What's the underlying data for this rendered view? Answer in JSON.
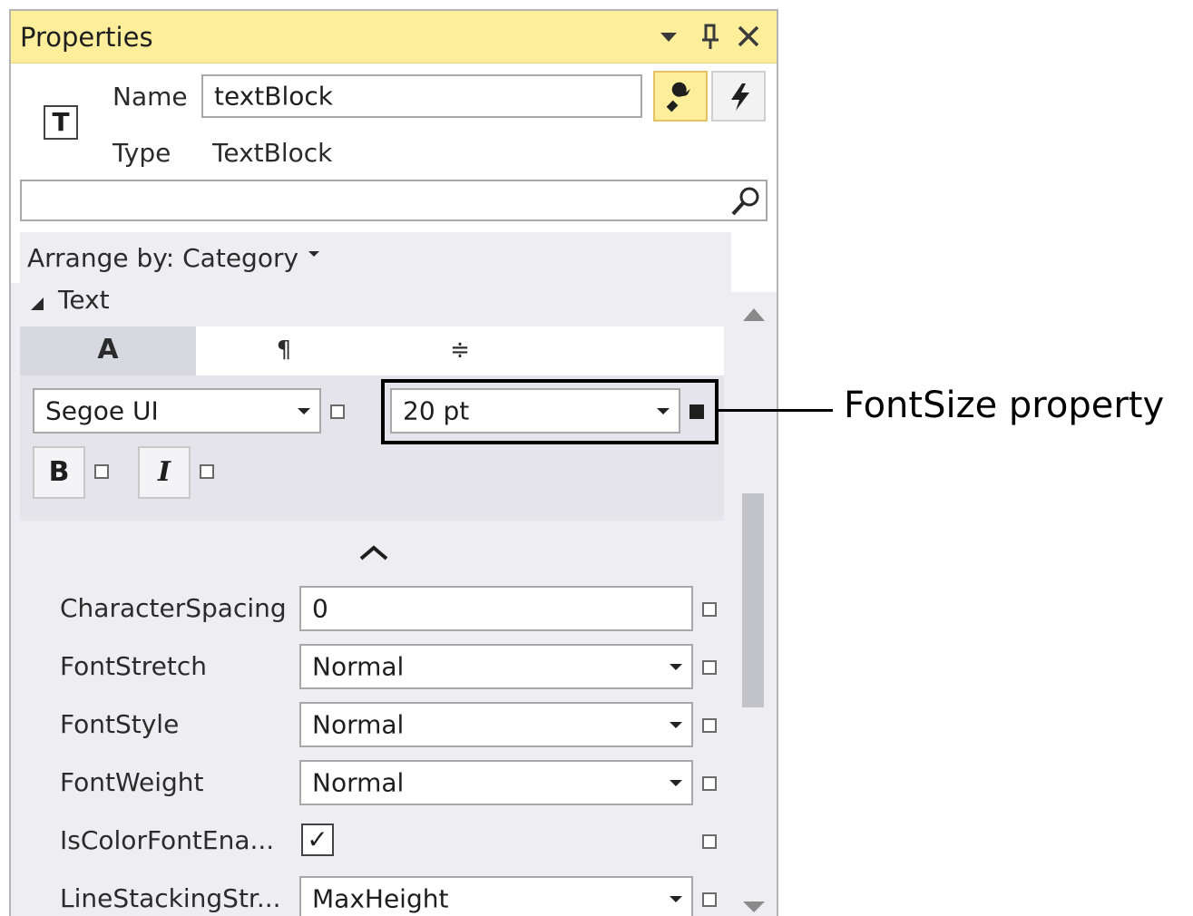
{
  "panel": {
    "title": "Properties",
    "title_icons": [
      "chevron-down-icon",
      "pin-icon",
      "close-icon"
    ],
    "name_label": "Name",
    "name_value": "textBlock",
    "type_label": "Type",
    "type_value": "TextBlock",
    "type_icon": "T",
    "search_placeholder": "",
    "arrange_label": "Arrange by: Category",
    "section_label": "Text",
    "text_tabs": [
      "A",
      "¶",
      "≑"
    ]
  },
  "text_section": {
    "font_family": "Segoe UI",
    "font_size": "20 pt",
    "bold_label": "B",
    "italic_label": "I"
  },
  "properties": [
    {
      "label": "CharacterSpacing",
      "value": "0",
      "kind": "text"
    },
    {
      "label": "FontStretch",
      "value": "Normal",
      "kind": "dropdown"
    },
    {
      "label": "FontStyle",
      "value": "Normal",
      "kind": "dropdown"
    },
    {
      "label": "FontWeight",
      "value": "Normal",
      "kind": "dropdown"
    },
    {
      "label": "IsColorFontEna...",
      "value": "✓",
      "kind": "checkbox"
    },
    {
      "label": "LineStackingStr...",
      "value": "MaxHeight",
      "kind": "dropdown"
    }
  ],
  "callout": {
    "label": "FontSize property"
  },
  "colors": {
    "titlebar": "#fcee9b",
    "active_toggle": "#fcee9b",
    "gray_area": "#eeeef2"
  }
}
